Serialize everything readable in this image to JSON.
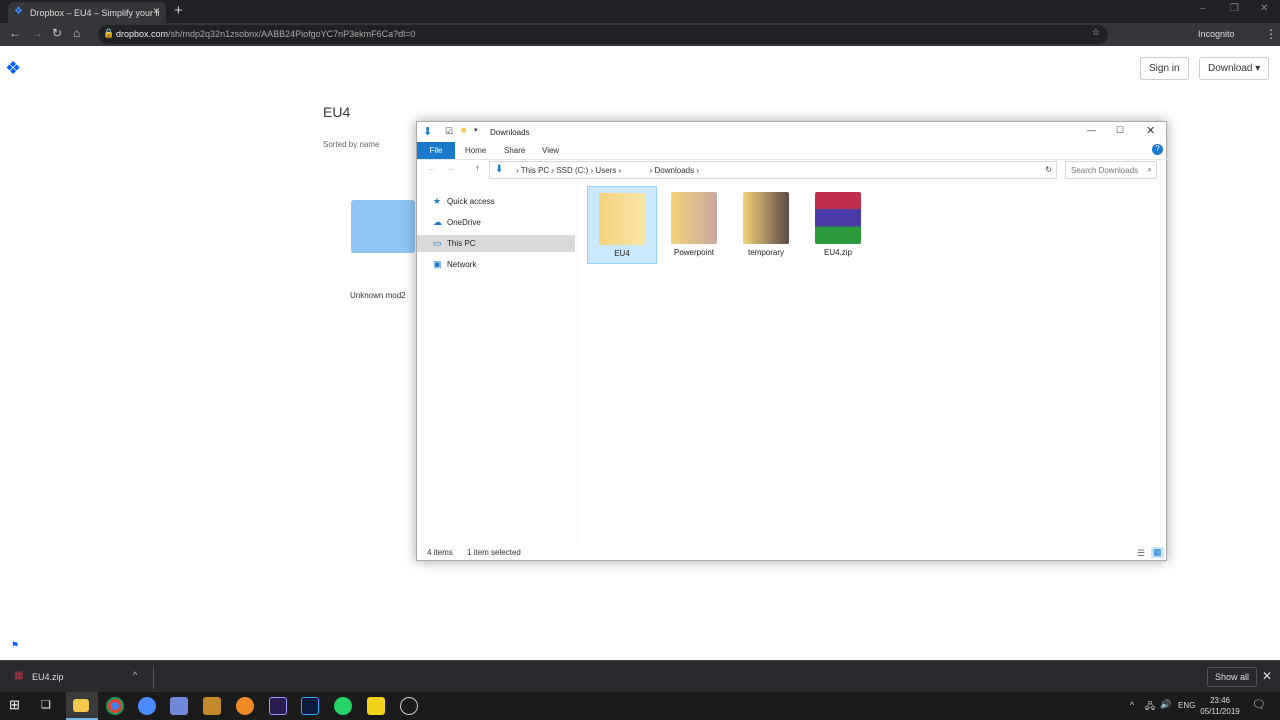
{
  "browser": {
    "tab_title": "Dropbox – EU4 – Simplify your li",
    "url_host": "dropbox.com",
    "url_path": "/sh/mdp2q32n1zsobnx/AABB24PiofgoYC7nP3ekmF6Ca?dl=0",
    "profile": "Incognito"
  },
  "dropbox": {
    "sign_in": "Sign in",
    "download": "Download ▾",
    "title": "EU4",
    "sort": "Sorted by name",
    "folder_name": "Unknown mod2",
    "accent": "#0061fe"
  },
  "explorer": {
    "title": "Downloads",
    "tabs": [
      "File",
      "Home",
      "Share",
      "View"
    ],
    "path": [
      "This PC",
      "SSD (C:)",
      "Users",
      "",
      "Downloads"
    ],
    "search_placeholder": "Search Downloads",
    "nav": [
      "Quick access",
      "OneDrive",
      "This PC",
      "Network"
    ],
    "items": [
      "EU4",
      "Powerpoint",
      "temporary",
      "EU4.zip"
    ],
    "status_count": "4 items",
    "status_selected": "1 item selected"
  },
  "download_bar": {
    "file": "EU4.zip",
    "show_all": "Show all"
  },
  "tray": {
    "lang": "ENG",
    "time": "23:46",
    "date": "05/11/2019"
  }
}
